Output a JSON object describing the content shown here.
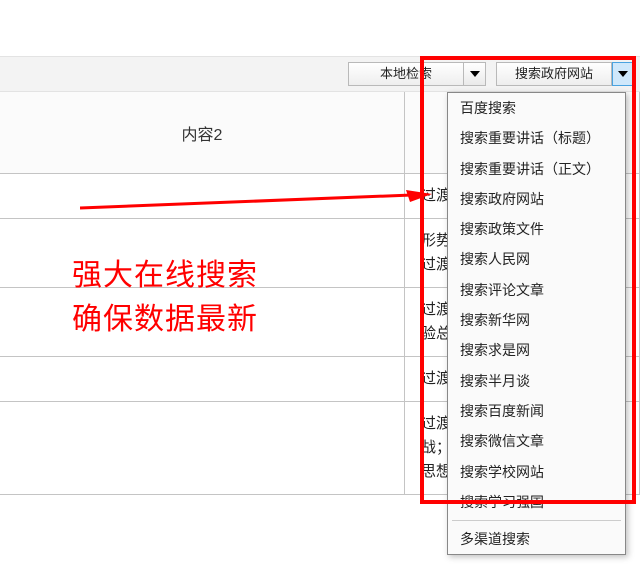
{
  "toolbar": {
    "combo1": {
      "label": "本地检索"
    },
    "combo2": {
      "label": "搜索政府网站"
    }
  },
  "table": {
    "headers": {
      "col2": "内容2",
      "col3": ""
    },
    "rows": [
      {
        "col2": "",
        "col3": "过渡"
      },
      {
        "col2": "",
        "col3": "形势；认识现状；鉴古看今；过渡语；过渡句"
      },
      {
        "col2": "",
        "col3": "过渡；过渡语；总结报告；经验总结；成效；"
      },
      {
        "col2": "",
        "col3": "过渡；过渡语；深化改革"
      },
      {
        "col2": "",
        "col3": "过渡；过渡语；过渡句；挑战；形势；机遇；认识；统一思想"
      }
    ]
  },
  "dropdown": {
    "items": [
      "百度搜索",
      "搜索重要讲话（标题）",
      "搜索重要讲话（正文）",
      "搜索政府网站",
      "搜索政策文件",
      "搜索人民网",
      "搜索评论文章",
      "搜索新华网",
      "搜索求是网",
      "搜索半月谈",
      "搜索百度新闻",
      "搜索微信文章",
      "搜索学校网站",
      "搜索学习强国"
    ],
    "footer": "多渠道搜索"
  },
  "annotation": {
    "line1": "强大在线搜索",
    "line2": "确保数据最新"
  }
}
